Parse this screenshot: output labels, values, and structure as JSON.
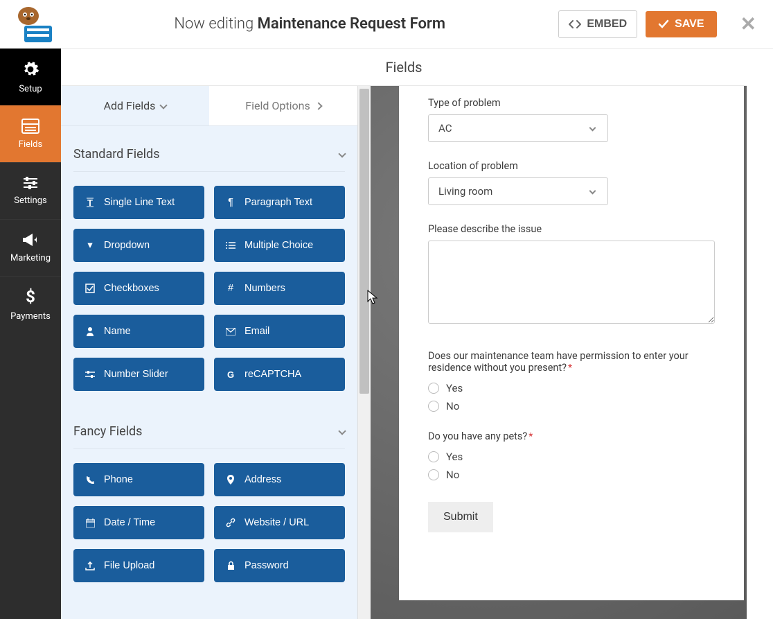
{
  "header": {
    "editing_prefix": "Now editing ",
    "form_name": "Maintenance Request Form",
    "embed_label": "EMBED",
    "save_label": "SAVE"
  },
  "sidebar": {
    "items": [
      {
        "id": "setup",
        "label": "Setup"
      },
      {
        "id": "fields",
        "label": "Fields"
      },
      {
        "id": "settings",
        "label": "Settings"
      },
      {
        "id": "marketing",
        "label": "Marketing"
      },
      {
        "id": "payments",
        "label": "Payments"
      }
    ]
  },
  "panel": {
    "title": "Fields",
    "tabs": {
      "add": "Add Fields",
      "options": "Field Options"
    },
    "sections": {
      "standard": {
        "title": "Standard Fields",
        "fields": [
          {
            "id": "single-line-text",
            "label": "Single Line Text"
          },
          {
            "id": "paragraph-text",
            "label": "Paragraph Text"
          },
          {
            "id": "dropdown",
            "label": "Dropdown"
          },
          {
            "id": "multiple-choice",
            "label": "Multiple Choice"
          },
          {
            "id": "checkboxes",
            "label": "Checkboxes"
          },
          {
            "id": "numbers",
            "label": "Numbers"
          },
          {
            "id": "name",
            "label": "Name"
          },
          {
            "id": "email",
            "label": "Email"
          },
          {
            "id": "number-slider",
            "label": "Number Slider"
          },
          {
            "id": "recaptcha",
            "label": "reCAPTCHA"
          }
        ]
      },
      "fancy": {
        "title": "Fancy Fields",
        "fields": [
          {
            "id": "phone",
            "label": "Phone"
          },
          {
            "id": "address",
            "label": "Address"
          },
          {
            "id": "date-time",
            "label": "Date / Time"
          },
          {
            "id": "website-url",
            "label": "Website / URL"
          },
          {
            "id": "file-upload",
            "label": "File Upload"
          },
          {
            "id": "password",
            "label": "Password"
          }
        ]
      }
    }
  },
  "preview": {
    "type_label": "Type of problem",
    "type_value": "AC",
    "location_label": "Location of problem",
    "location_value": "Living room",
    "describe_label": "Please describe the issue",
    "permission_label": "Does our maintenance team have permission to enter your residence without you present?",
    "permission_required": "*",
    "pets_label": "Do you have any pets?",
    "pets_required": "*",
    "option_yes": "Yes",
    "option_no": "No",
    "submit_label": "Submit"
  },
  "colors": {
    "accent": "#e27730",
    "field_btn": "#1a5d9c"
  }
}
